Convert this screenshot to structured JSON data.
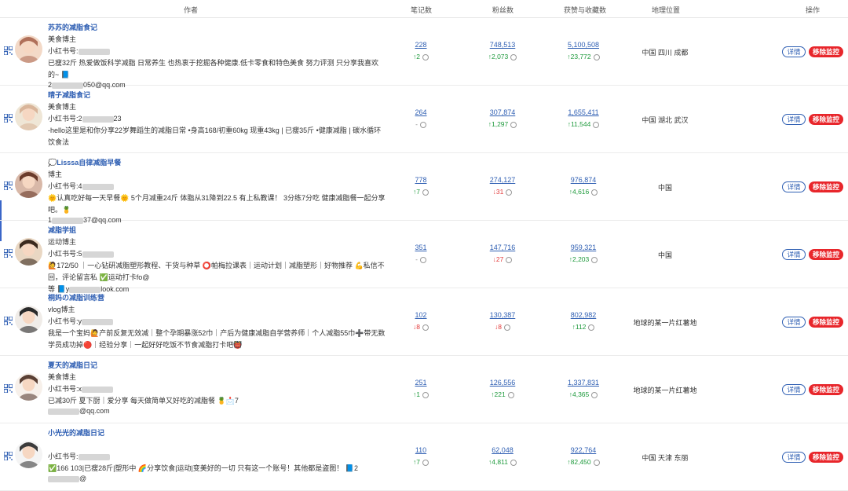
{
  "columns": {
    "author": "作者",
    "notes": "笔记数",
    "fans": "粉丝数",
    "likes": "获赞与收藏数",
    "location": "地理位置",
    "actions": "操作"
  },
  "actions": {
    "detail": "详情",
    "remove": "移除监控"
  },
  "colors": {
    "link": "#2f5fb3",
    "up": "#1e9a3c",
    "down": "#e23a3a",
    "remove": "#e8262b"
  },
  "rows": [
    {
      "name": "苏苏的减脂食记",
      "category": "美食博主",
      "xhs_prefix": "小红书号:",
      "desc": "已瘦32斤 热爱做饭科学减脂 日常养生 也热衷于挖掘各种健康.低卡零食和特色美食 努力评测 只分享我喜欢的~ 📘",
      "email_prefix": "2",
      "email_suffix": "050@qq.com",
      "notes": "228",
      "notes_delta": "↑2",
      "fans": "748,513",
      "fans_delta": "↑2,073",
      "likes": "5,100,508",
      "likes_delta": "↑23,772",
      "location": "中国 四川 成都"
    },
    {
      "name": "晴子减脂食记",
      "category": "美食博主",
      "xhs_prefix": "小红书号:2",
      "xhs_suffix": "23",
      "desc": "-hello这里是和你分享22岁舞蹈生的减脂日常 •身高168/初重60kg 现重43kg | 已瘦35斤 •健康减脂 | 碳水循环饮食法",
      "notes": "264",
      "notes_delta": "-",
      "fans": "307,874",
      "fans_delta": "↑1,297",
      "likes": "1,655,411",
      "likes_delta": "↑11,544",
      "location": "中国 湖北 武汉"
    },
    {
      "name": "💭Lisssa自律减脂早餐",
      "category": "博主",
      "xhs_prefix": "小红书号:4",
      "desc": "🌞认真吃好每一天早餐🌞 5个月减重24斤 体脂从31降到22.5 有上私教课！ 3分练7分吃 健康减脂餐一起分享吧。🍍",
      "email_prefix": "1",
      "email_suffix": "37@qq.com",
      "notes": "778",
      "notes_delta": "↑7",
      "fans": "274,127",
      "fans_delta": "↓31",
      "likes": "976,874",
      "likes_delta": "↑4,616",
      "location": "中国"
    },
    {
      "name": "减脂学姐",
      "category": "运动博主",
      "xhs_prefix": "小红书号:5",
      "desc": "🙋172/50 ｜一心钻研减脂塑形教程、干货与种草 ⭕帕梅拉课表｜运动计划｜减脂塑形｜好物推荐 💪私信不回，评论留言私 ✅运动打卡fo@",
      "email_prefix": "等 📘y",
      "email_suffix": "look.com",
      "notes": "351",
      "notes_delta": "-",
      "fans": "147,716",
      "fans_delta": "↓27",
      "likes": "959,321",
      "likes_delta": "↑2,203",
      "location": "中国"
    },
    {
      "name": "桐妈の减脂训练营",
      "category": "vlog博主",
      "xhs_prefix": "小红书号:y",
      "desc": "我是一个宝妈🙋产前反复无效减｜整个孕期暴涨52巾｜产后为健康减脂自学营养师｜个人减脂55巾➕带无数学员成功掉🔴｜经验分享｜一起好好吃饭不节食减脂打卡吧👹",
      "notes": "102",
      "notes_delta": "↓8",
      "fans": "130,387",
      "fans_delta": "↓8",
      "likes": "802,982",
      "likes_delta": "↑112",
      "location": "地球的某一片红薯地"
    },
    {
      "name": "夏天的减脂日记",
      "category": "美食博主",
      "xhs_prefix": "小红书号:x",
      "desc": "已减30斤 夏下厨｜爱分享 每天做简单又好吃的减脂餐 🍍📩7",
      "email_suffix": "@qq.com",
      "notes": "251",
      "notes_delta": "↑1",
      "fans": "126,556",
      "fans_delta": "↑221",
      "likes": "1,337,831",
      "likes_delta": "↑4,365",
      "location": "地球的某一片红薯地"
    },
    {
      "name": "小光光的减脂日记",
      "category": "",
      "xhs_prefix": "小红书号:",
      "desc": "✅166 103|已瘦28斤|塑形中 🌈分享饮食|运动|变美好的一切 只有这一个账号！其他都是盗图！ 📘2",
      "email_suffix": "@",
      "notes": "110",
      "notes_delta": "↑7",
      "fans": "62,048",
      "fans_delta": "↑4,811",
      "likes": "922,764",
      "likes_delta": "↑82,450",
      "location": "中国 天津 东丽"
    }
  ]
}
